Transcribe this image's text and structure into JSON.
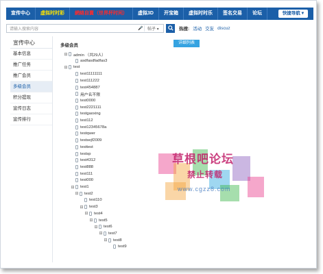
{
  "topnav": {
    "items": [
      {
        "label": "宣传中心",
        "style": "normal"
      },
      {
        "label": "虚拟时时彩",
        "style": "yellow"
      },
      {
        "label": "網絡自賣（世界杯时间）",
        "style": "red"
      },
      {
        "label": "虚拟3D",
        "style": "normal"
      },
      {
        "label": "开宝箱",
        "style": "normal"
      },
      {
        "label": "虚拟时时乐",
        "style": "normal"
      },
      {
        "label": "签名交易",
        "style": "normal"
      },
      {
        "label": "论坛",
        "style": "normal"
      }
    ],
    "quick_nav": "快捷导航 ▾"
  },
  "search": {
    "placeholder": "请输入搜索内容",
    "mic_icon": "microphone-icon",
    "scope": "帖子 ▾",
    "button_icon": "search-icon",
    "hot_label": "热搜:",
    "hot_links": [
      "活动",
      "交友",
      "discuz"
    ]
  },
  "sidebar": {
    "title": "宣传中心",
    "items": [
      {
        "label": "基本信息",
        "active": false
      },
      {
        "label": "推广任务",
        "active": false
      },
      {
        "label": "推广会员",
        "active": false
      },
      {
        "label": "多级会员",
        "active": true
      },
      {
        "label": "积分提现",
        "active": false
      },
      {
        "label": "宣传日志",
        "active": false
      },
      {
        "label": "宣传排行",
        "active": false
      }
    ]
  },
  "content": {
    "title": "多级会员",
    "detail_button": "详细列表",
    "tree": [
      {
        "label": "admin （共29人）",
        "depth": 0,
        "toggle": "⊟"
      },
      {
        "label": "asdfasdfadfas3",
        "depth": 1,
        "toggle": ""
      },
      {
        "label": "test",
        "depth": 0,
        "toggle": "⊟"
      },
      {
        "label": "test11111111",
        "depth": 1,
        "toggle": ""
      },
      {
        "label": "test111222",
        "depth": 1,
        "toggle": ""
      },
      {
        "label": "test454887",
        "depth": 1,
        "toggle": ""
      },
      {
        "label": "用户名不限",
        "depth": 1,
        "toggle": ""
      },
      {
        "label": "test0000",
        "depth": 1,
        "toggle": ""
      },
      {
        "label": "test2221111",
        "depth": 1,
        "toggle": ""
      },
      {
        "label": "testgaoxing",
        "depth": 1,
        "toggle": ""
      },
      {
        "label": "test112",
        "depth": 1,
        "toggle": ""
      },
      {
        "label": "test12345678a",
        "depth": 1,
        "toggle": ""
      },
      {
        "label": "testqwer",
        "depth": 1,
        "toggle": ""
      },
      {
        "label": "testsejf2009",
        "depth": 1,
        "toggle": ""
      },
      {
        "label": "testtest",
        "depth": 1,
        "toggle": ""
      },
      {
        "label": "testsp",
        "depth": 1,
        "toggle": ""
      },
      {
        "label": "test4312",
        "depth": 1,
        "toggle": ""
      },
      {
        "label": "test888",
        "depth": 1,
        "toggle": ""
      },
      {
        "label": "test111",
        "depth": 1,
        "toggle": ""
      },
      {
        "label": "test000",
        "depth": 1,
        "toggle": ""
      },
      {
        "label": "test1",
        "depth": 1,
        "toggle": "⊟"
      },
      {
        "label": "test2",
        "depth": 2,
        "toggle": "⊟"
      },
      {
        "label": "test110",
        "depth": 3,
        "toggle": ""
      },
      {
        "label": "test3",
        "depth": 3,
        "toggle": "⊟"
      },
      {
        "label": "test4",
        "depth": 4,
        "toggle": "⊟"
      },
      {
        "label": "test5",
        "depth": 5,
        "toggle": "⊟"
      },
      {
        "label": "test6",
        "depth": 6,
        "toggle": "⊟"
      },
      {
        "label": "test7",
        "depth": 7,
        "toggle": "⊟"
      },
      {
        "label": "test8",
        "depth": 8,
        "toggle": "⊟"
      },
      {
        "label": "test9",
        "depth": 9,
        "toggle": ""
      }
    ]
  },
  "watermark": {
    "line1": "草根吧论坛",
    "line2": "禁止转载",
    "line3": "www.cgzz8.com",
    "colors": [
      "#e83c8c",
      "#f3a33b",
      "#39b54a",
      "#2aa6df",
      "#8b5fbf"
    ]
  },
  "colors": {
    "nav_bg": "#1b5fa8",
    "accent": "#35a3e1",
    "highlight_yellow": "#ffe400",
    "highlight_red": "#ff2a2a"
  }
}
